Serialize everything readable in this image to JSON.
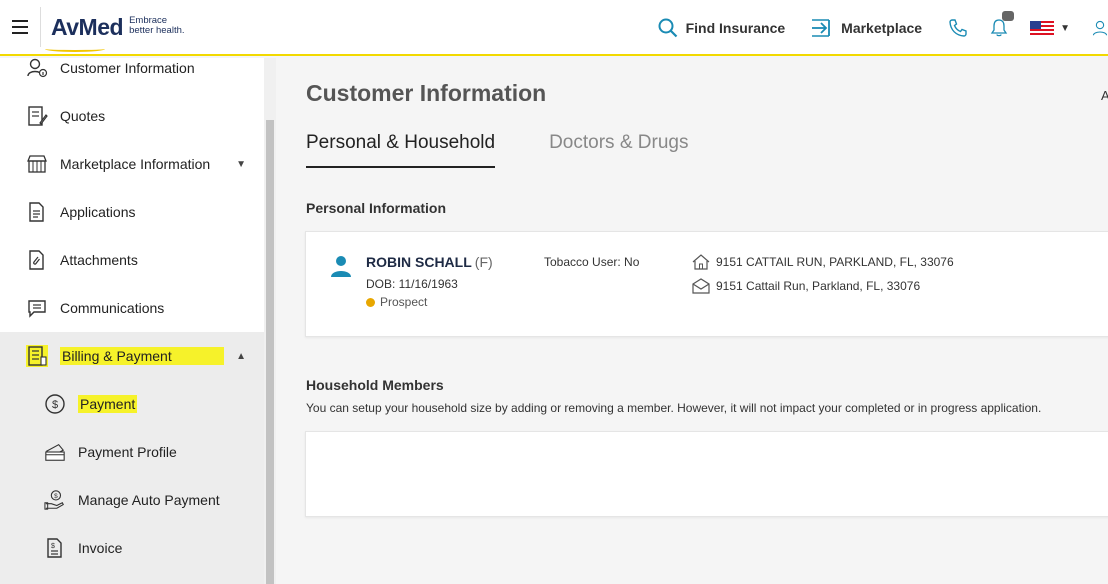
{
  "header": {
    "menu_icon": "hamburger-icon",
    "logo_text": "AvMed",
    "logo_tagline_1": "Embrace",
    "logo_tagline_2": "better health.",
    "find_insurance": "Find Insurance",
    "marketplace": "Marketplace",
    "icons": [
      "search-icon",
      "arrow-right-to-bar-icon",
      "phone-icon",
      "bell-icon",
      "us-flag-icon",
      "user-icon"
    ]
  },
  "sidebar": {
    "items": [
      {
        "label": "Customer Information",
        "icon": "customer-info-icon"
      },
      {
        "label": "Quotes",
        "icon": "quotes-icon"
      },
      {
        "label": "Marketplace Information",
        "icon": "marketplace-icon"
      },
      {
        "label": "Applications",
        "icon": "applications-icon"
      },
      {
        "label": "Attachments",
        "icon": "attachments-icon"
      },
      {
        "label": "Communications",
        "icon": "communications-icon"
      },
      {
        "label": "Billing & Payment",
        "icon": "billing-icon"
      }
    ],
    "billing_sub": [
      {
        "label": "Payment",
        "icon": "dollar-circle-icon"
      },
      {
        "label": "Payment Profile",
        "icon": "credit-card-icon"
      },
      {
        "label": "Manage Auto Payment",
        "icon": "hand-coin-icon"
      },
      {
        "label": "Invoice",
        "icon": "invoice-icon"
      }
    ]
  },
  "main": {
    "title": "Customer Information",
    "edge_text": "A",
    "tabs": [
      {
        "label": "Personal & Household",
        "active": true
      },
      {
        "label": "Doctors & Drugs",
        "active": false
      }
    ],
    "personal_heading": "Personal Information",
    "person": {
      "name": "ROBIN SCHALL",
      "gender": "(F)",
      "dob": "DOB: 11/16/1963",
      "status": "Prospect",
      "tobacco": "Tobacco User: No",
      "home_address": "9151 CATTAIL RUN, PARKLAND, FL, 33076",
      "mail_address": "9151 Cattail Run, Parkland, FL, 33076"
    },
    "household_heading": "Household Members",
    "household_desc": "You can setup your household size by adding or removing a member. However, it will not impact your completed or in progress application."
  },
  "colors": {
    "accent_yellow": "#f2d900",
    "highlight": "#f6f22a",
    "brand_navy": "#1c2f5c",
    "person_teal": "#1a8bb4",
    "prospect_dot": "#e8a700"
  }
}
